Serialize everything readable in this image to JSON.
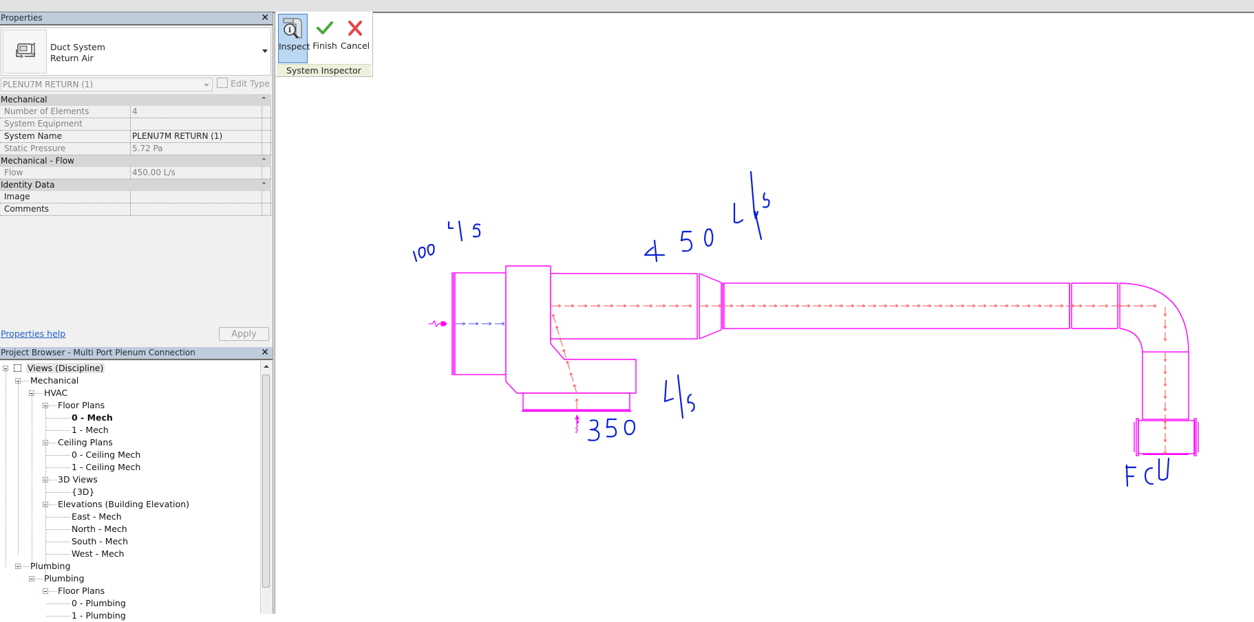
{
  "properties": {
    "title": "Properties",
    "type_family": "Duct System",
    "type_name": "Return Air",
    "type_selector_value": "PLENU7M RETURN (1)",
    "edit_type_label": "Edit Type",
    "groups": [
      {
        "label": "Mechanical",
        "rows": [
          {
            "key": "Number of Elements",
            "value": "4",
            "editable": false
          },
          {
            "key": "System Equipment",
            "value": "",
            "editable": false
          },
          {
            "key": "System Name",
            "value": "PLENU7M RETURN (1)",
            "editable": true
          },
          {
            "key": "Static Pressure",
            "value": "5.72 Pa",
            "editable": false
          }
        ]
      },
      {
        "label": "Mechanical - Flow",
        "rows": [
          {
            "key": "Flow",
            "value": "450.00 L/s",
            "editable": false
          }
        ]
      },
      {
        "label": "Identity Data",
        "rows": [
          {
            "key": "Image",
            "value": "",
            "editable": true
          },
          {
            "key": "Comments",
            "value": "",
            "editable": true
          }
        ]
      }
    ],
    "help_link": "Properties help",
    "apply_label": "Apply"
  },
  "browser": {
    "title": "Project Browser - Multi Port Plenum Connection",
    "nodes": [
      {
        "label": "Views (Discipline)",
        "level": 0,
        "expander": true,
        "root": true
      },
      {
        "label": "Mechanical",
        "level": 1,
        "expander": true
      },
      {
        "label": "HVAC",
        "level": 2,
        "expander": true
      },
      {
        "label": "Floor Plans",
        "level": 3,
        "expander": true
      },
      {
        "label": "0 - Mech",
        "level": 4,
        "bold": true
      },
      {
        "label": "1 - Mech",
        "level": 4
      },
      {
        "label": "Ceiling Plans",
        "level": 3,
        "expander": true
      },
      {
        "label": "0 - Ceiling Mech",
        "level": 4
      },
      {
        "label": "1 - Ceiling Mech",
        "level": 4
      },
      {
        "label": "3D Views",
        "level": 3,
        "expander": true
      },
      {
        "label": "{3D}",
        "level": 4
      },
      {
        "label": "Elevations (Building Elevation)",
        "level": 3,
        "expander": true
      },
      {
        "label": "East - Mech",
        "level": 4
      },
      {
        "label": "North - Mech",
        "level": 4
      },
      {
        "label": "South - Mech",
        "level": 4
      },
      {
        "label": "West - Mech",
        "level": 4
      },
      {
        "label": "Plumbing",
        "level": 1,
        "expander": true
      },
      {
        "label": "Plumbing",
        "level": 2,
        "expander": true
      },
      {
        "label": "Floor Plans",
        "level": 3,
        "expander": true
      },
      {
        "label": "0 - Plumbing",
        "level": 4
      },
      {
        "label": "1 - Plumbing",
        "level": 4
      }
    ]
  },
  "ribbon": {
    "panel_label": "System Inspector",
    "buttons": [
      {
        "label": "Inspect",
        "icon": "inspect-icon",
        "active": true
      },
      {
        "label": "Finish",
        "icon": "checkmark-icon"
      },
      {
        "label": "Cancel",
        "icon": "cancel-x-icon"
      }
    ]
  },
  "drawing": {
    "colors": {
      "duct": "#ff00ff",
      "flow_arrow": "#ff6a6a",
      "inlet_arrow": "#6a6aff",
      "markup": "#0a1fd6"
    },
    "annotations": {
      "inlet_left": "100 L/s",
      "main": "450 L/s",
      "inlet_bottom": "350 L/s",
      "equipment": "FCU"
    }
  }
}
